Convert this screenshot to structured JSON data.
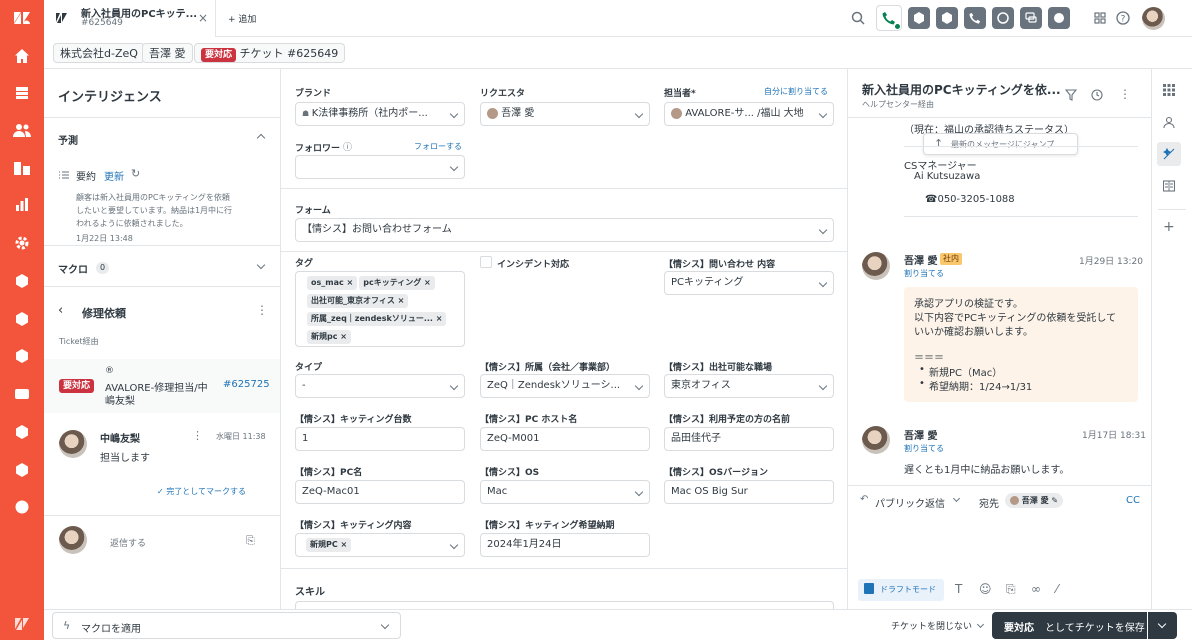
{
  "tab": {
    "title": "新入社員用のPCキッテ...",
    "number": "#625649",
    "close": "×",
    "add_label": "+ 追加"
  },
  "crumbs": {
    "org": "株式会社d-ZeQ",
    "user": "吾澤 愛",
    "status": "要対応",
    "ticket": "チケット #625649"
  },
  "left": {
    "title": "インテリジェンス",
    "predict": "予測",
    "summary_label": "要約",
    "summary_update": "更新",
    "summary_text_1": "顧客は新入社員用のPCキッティングを依頼",
    "summary_text_2": "したいと要望しています。納品は1月中に行",
    "summary_text_3": "われるように依頼されました。",
    "summary_date": "1月22日 13:48",
    "macro": "マクロ",
    "macro_count": "0",
    "repair_title": "修理依頼",
    "ticket_via": "Ticket経由",
    "item_status": "要対応",
    "item_line1": "AVALORE-修理担当/中",
    "item_line2": "嶋友梨",
    "item_number": "#625725",
    "agent_name": "中嶋友梨",
    "agent_time": "水曜日 11:38",
    "agent_msg": "担当します",
    "mark_done": "✓ 完了としてマークする",
    "reply_placeholder": "返信する"
  },
  "form": {
    "brand_label": "ブランド",
    "brand_value": "K法律事務所（社内ポー...",
    "requester_label": "リクエスタ",
    "requester_value": "吾澤 愛",
    "assignee_label": "担当者*",
    "assign_self": "自分に割り当てる",
    "assignee_value": "AVALORE-サ... /福山 大地",
    "follower_label": "フォロワー",
    "follow_link": "フォローする",
    "form_label": "フォーム",
    "form_value": "【情シス】お問い合わせフォーム",
    "tags_label": "タグ",
    "tags": [
      "os_mac ×",
      "pcキッティング ×",
      "出社可能_東京オフィス ×",
      "所属_zeq｜zendeskソリュー... ×",
      "新規pc ×"
    ],
    "incident_label": "インシデント対応",
    "inquiry_label": "【情シス】問い合わせ 内容",
    "inquiry_value": "PCキッティング",
    "type_label": "タイプ",
    "type_value": "-",
    "affil_label": "【情シス】所属（会社／事業部）",
    "affil_value": "ZeQ｜Zendeskソリューシ...",
    "office_label": "【情シス】出社可能な職場",
    "office_value": "東京オフィス",
    "count_label": "【情シス】キッティング台数",
    "count_value": "1",
    "host_label": "【情シス】PC ホスト名",
    "host_value": "ZeQ-M001",
    "user_label": "【情シス】利用予定の方の名前",
    "user_value": "品田佳代子",
    "pcname_label": "【情シス】PC名",
    "pcname_value": "ZeQ-Mac01",
    "os_label": "【情シス】OS",
    "os_value": "Mac",
    "osver_label": "【情シス】OSバージョン",
    "osver_value": "Mac OS Big Sur",
    "kit_label": "【情シス】キッティング内容",
    "kit_tag": "新規PC ×",
    "due_label": "【情シス】キッティング希望納期",
    "due_value": "2024年1月24日",
    "skill_label": "スキル"
  },
  "conv": {
    "title": "新入社員用のPCキッティングを依...",
    "subtitle": "ヘルプセンター経由",
    "prev_line": "（現在：福山の承認待ちステータス）",
    "jump": "最新のメッセージにジャンプ",
    "sig1": "CSマネージャー",
    "sig2": "Ai Kutsuzawa",
    "sig3": "☎050-3205-1088",
    "m1_name": "吾澤 愛",
    "m1_badge": "社内",
    "m1_time": "1月29日 13:20",
    "m1_assign": "割り当てる",
    "m1_l1": "承認アプリの検証です。",
    "m1_l2": "以下内容でPCキッティングの依頼を受託して",
    "m1_l3": "いいか確認お願いします。",
    "m1_l4": "＝＝＝",
    "m1_b1": "新規PC（Mac）",
    "m1_b2": "希望納期：1/24→1/31",
    "m2_name": "吾澤 愛",
    "m2_time": "1月17日 18:31",
    "m2_assign": "割り当てる",
    "m2_text": "遅くとも1月中に納品お願いします。",
    "reply_mode": "パブリック返信",
    "to_label": "宛先",
    "to_value": "吾澤 愛",
    "cc": "CC",
    "draft": "ドラフトモード"
  },
  "bottom": {
    "macro_apply": "マクロを適用",
    "close_label": "チケットを閉じない",
    "save_bold": "要対応",
    "save_rest": "としてチケットを保存"
  },
  "colors": {
    "accent": "#f2553b",
    "link": "#1f73b7",
    "danger": "#cc3340",
    "save": "#2f3941",
    "internal": "#fdf3e8"
  }
}
